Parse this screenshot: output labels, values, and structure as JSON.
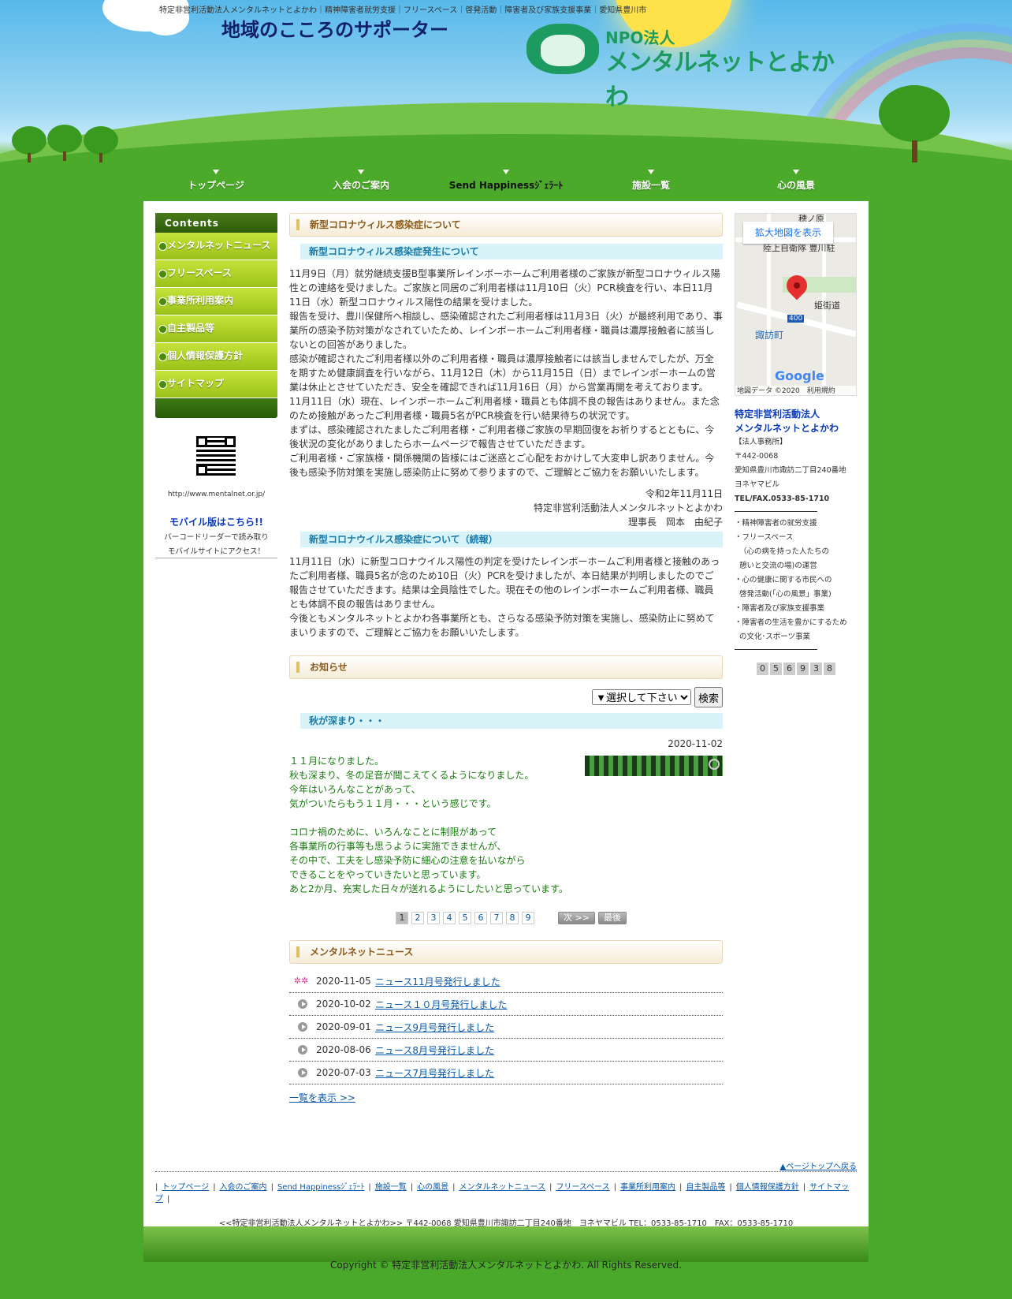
{
  "header": {
    "topline": "特定非営利活動法人メンタルネットとよかわ｜精神障害者就労支援｜フリースペース｜啓発活動｜障害者及び家族支援事業｜愛知県豊川市",
    "catchcopy": "地域のこころのサポーター",
    "logo_npo": "NPO法人",
    "logo_name": "メンタルネットとよかわ"
  },
  "gnav": [
    "トップページ",
    "入会のご案内",
    "Send Happinessｼﾞｪﾗｰﾄ",
    "施設一覧",
    "心の風景"
  ],
  "sidebar": {
    "title": "Contents",
    "items": [
      "メンタルネットニュース",
      "フリースペース",
      "事業所利用案内",
      "自主製品等",
      "個人情報保護方針",
      "サイトマップ"
    ],
    "url": "http://www.mentalnet.or.jp/",
    "mobile_link": "モバイル版はこちら!!",
    "mobile_desc1": "バーコードリーダーで読み取り",
    "mobile_desc2": "モバイルサイトにアクセス！"
  },
  "covid": {
    "title": "新型コロナウィルス感染症について",
    "subtitle1": "新型コロナウィルス感染症発生について",
    "body1": "11月9日（月）就労継続支援B型事業所レインボーホームご利用者様のご家族が新型コロナウィルス陽性との連絡を受けました。ご家族と同居のご利用者様は11月10日（火）PCR検査を行い、本日11月11日（水）新型コロナウィルス陽性の結果を受けました。\n報告を受け、豊川保健所へ相談し、感染確認されたご利用者様は11月3日（火）が最終利用であり、事業所の感染予防対策がなされていたため、レインボーホームご利用者様・職員は濃厚接触者に該当しないとの回答がありました。\n感染が確認されたご利用者様以外のご利用者様・職員は濃厚接触者には該当しませんでしたが、万全を期すため健康調査を行いながら、11月12日（木）から11月15日（日）までレインボーホームの営業は休止とさせていただき、安全を確認できれば11月16日（月）から営業再開を考えております。\n11月11日（水）現在、レインボーホームご利用者様・職員とも体調不良の報告はありません。また念のため接触があったご利用者様・職員5名がPCR検査を行い結果待ちの状況です。\nまずは、感染確認されたましたご利用者様・ご利用者様ご家族の早期回復をお祈りするとともに、今後状況の変化がありましたらホームページで報告させていただきます。\nご利用者様・ご家族様・関係機関の皆様にはご迷惑とご心配をおかけして大変申し訳ありません。今後も感染予防対策を実施し感染防止に努めて参りますので、ご理解とご協力をお願いいたします。",
    "date": "令和2年11月11日",
    "org": "特定非営利活動法人メンタルネットとよかわ",
    "chair": "理事長　岡本　由紀子",
    "subtitle2": "新型コロナウイルス感染症について（続報）",
    "body2": "11月11日（水）に新型コロナウイルス陽性の判定を受けたレインボーホームご利用者様と接触のあったご利用者様、職員5名が念のため10日（火）PCRを受けましたが、本日結果が判明しましたのでご報告させていただきます。結果は全員陰性でした。現在その他のレインボーホームご利用者様、職員とも体調不良の報告はありません。\n今後ともメンタルネットとよかわ各事業所とも、さらなる感染予防対策を実施し、感染防止に努めてまいりますので、ご理解とご協力をお願いいたします。"
  },
  "notice": {
    "title": "お知らせ",
    "select_value": "▼選択して下さい",
    "search_button": "検索",
    "post_title": "秋が深まり・・・",
    "post_date": "2020-11-02",
    "post_body": "１１月になりました。\n秋も深まり、冬の足音が聞こえてくるようになりました。\n今年はいろんなことがあって、\n気がついたらもう１１月・・・という感じです。\n\nコロナ禍のために、いろんなことに制限があって\n各事業所の行事等も思うように実施できませんが、\nその中で、工夫をし感染予防に細心の注意を払いながら\nできることをやっていきたいと思っています。\nあと2か月、充実した日々が送れるようにしたいと思っています。",
    "pages": [
      "1",
      "2",
      "3",
      "4",
      "5",
      "6",
      "7",
      "8",
      "9"
    ],
    "next": "次 >>",
    "last": "最後"
  },
  "news": {
    "title": "メンタルネットニュース",
    "items": [
      {
        "date": "2020-11-05",
        "text": "ニュース11月号発行しました",
        "icon": "new-icon"
      },
      {
        "date": "2020-10-02",
        "text": "ニュース１０月号発行しました",
        "icon": "arrow-icon"
      },
      {
        "date": "2020-09-01",
        "text": "ニュース9月号発行しました",
        "icon": "arrow-icon"
      },
      {
        "date": "2020-08-06",
        "text": "ニュース8月号発行しました",
        "icon": "arrow-icon"
      },
      {
        "date": "2020-07-03",
        "text": "ニュース7月号発行しました",
        "icon": "arrow-icon"
      }
    ],
    "more": "一覧を表示 >>"
  },
  "rside": {
    "map_link": "拡大地図を表示",
    "map_label1": "穂ノ原",
    "map_label2": "陸上自衛隊 豊川駐",
    "map_label3": "姫街道",
    "map_label4": "諏訪町",
    "map_route": "400",
    "map_brand": "Google",
    "map_footer": "地図データ ©2020　利用規約",
    "org1": "特定非営利活動法人",
    "org2": "メンタルネットとよかわ",
    "office": "【法人事務所】",
    "zip": "〒442-0068",
    "addr": "愛知県豊川市諏訪二丁目240番地",
    "bldg": "ヨネヤマビル",
    "tel": "TEL/FAX.0533-85-1710",
    "services": [
      "・精神障害者の就労支援",
      "・フリースペース",
      "（心の病を持った人たちの",
      "憩いと交流の場)の運営",
      "・心の健康に関する市民への",
      "啓発活動(「心の風景」事業)",
      "・障害者及び家族支援事業",
      "・障害者の生活を豊かにするため",
      "の文化･スポーツ事業"
    ],
    "counter": [
      "0",
      "5",
      "6",
      "9",
      "3",
      "8"
    ]
  },
  "footer": {
    "totop": "▲ページトップへ戻る",
    "links": [
      "トップページ",
      "入会のご案内",
      "Send Happinessｼﾞｪﾗｰﾄ",
      "施設一覧",
      "心の風景",
      "メンタルネットニュース",
      "フリースペース",
      "事業所利用案内",
      "自主製品等",
      "個人情報保護方針",
      "サイトマップ"
    ],
    "address": "<<特定非営利活動法人メンタルネットとよかわ>> 〒442-0068 愛知県豊川市諏訪二丁目240番地　ヨネヤマビル TEL：0533-85-1710　FAX：0533-85-1710",
    "copyright": "Copyright © 特定非営利活動法人メンタルネットとよかわ. All Rights Reserved."
  }
}
